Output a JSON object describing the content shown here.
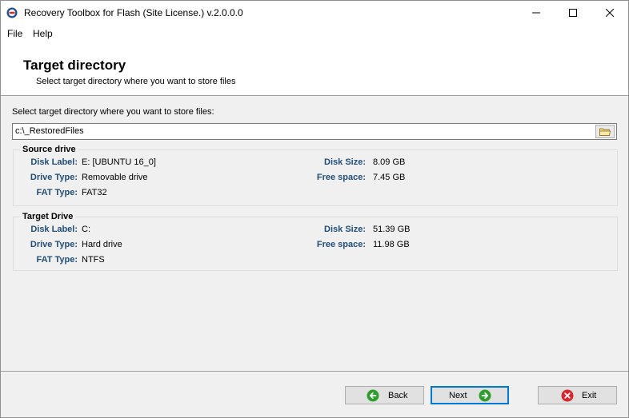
{
  "window": {
    "title": "Recovery Toolbox for Flash (Site License.) v.2.0.0.0"
  },
  "menu": {
    "file": "File",
    "help": "Help"
  },
  "header": {
    "title": "Target directory",
    "subtitle": "Select target directory where you want to store files"
  },
  "target": {
    "label": "Select target directory where you want to store files:",
    "path": "c:\\_RestoredFiles"
  },
  "source_drive": {
    "title": "Source drive",
    "disk_label_key": "Disk Label:",
    "disk_label": "E: [UBUNTU 16_0]",
    "drive_type_key": "Drive Type:",
    "drive_type": "Removable drive",
    "fat_type_key": "FAT Type:",
    "fat_type": "FAT32",
    "disk_size_key": "Disk Size:",
    "disk_size": "8.09 GB",
    "free_space_key": "Free space:",
    "free_space": "7.45 GB"
  },
  "target_drive": {
    "title": "Target Drive",
    "disk_label_key": "Disk Label:",
    "disk_label": "C:",
    "drive_type_key": "Drive Type:",
    "drive_type": "Hard drive",
    "fat_type_key": "FAT Type:",
    "fat_type": "NTFS",
    "disk_size_key": "Disk Size:",
    "disk_size": "51.39 GB",
    "free_space_key": "Free space:",
    "free_space": "11.98 GB"
  },
  "buttons": {
    "back": "Back",
    "next": "Next",
    "exit": "Exit"
  },
  "icons": {
    "app": "recovery-app-icon",
    "minimize": "minimize-icon",
    "maximize": "maximize-icon",
    "close": "close-icon",
    "browse": "folder-icon",
    "back": "back-arrow-icon",
    "next": "next-arrow-icon",
    "exit": "exit-x-icon"
  },
  "colors": {
    "label_blue": "#1f4e79",
    "focus_border": "#0078d7",
    "arrow_green": "#2e9e2e",
    "exit_red": "#d9262b"
  }
}
